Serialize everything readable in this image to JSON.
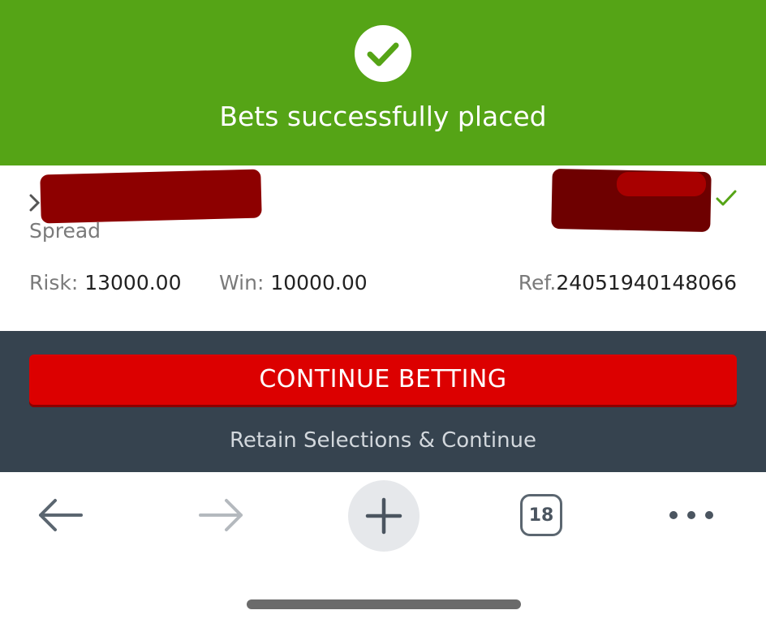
{
  "banner": {
    "message": "Bets successfully placed",
    "icon": "checkmark-circle-icon",
    "color": "#55a416"
  },
  "bet": {
    "market": "Spread",
    "risk_label": "Risk:",
    "risk_value": "13000.00",
    "win_label": "Win:",
    "win_value": "10000.00",
    "ref_label": "Ref.",
    "ref_value": "24051940148066",
    "status_icon": "checkmark-icon"
  },
  "actions": {
    "continue_label": "CONTINUE BETTING",
    "retain_label": "Retain Selections & Continue",
    "button_color": "#dc0000",
    "panel_color": "#36434f"
  },
  "browser_toolbar": {
    "back_icon": "arrow-left-icon",
    "forward_icon": "arrow-right-icon",
    "new_tab_icon": "plus-icon",
    "tab_count": "18",
    "more_icon": "more-dots-icon"
  }
}
